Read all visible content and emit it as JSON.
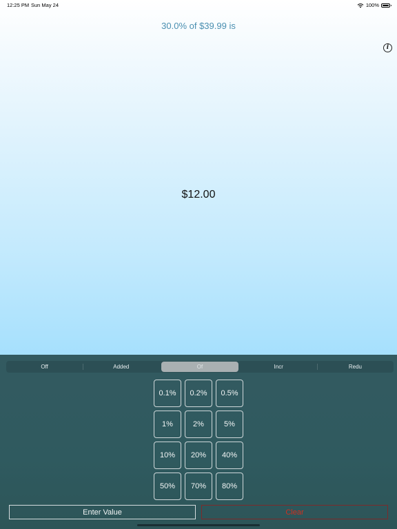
{
  "status_bar": {
    "time": "12:25 PM",
    "date": "Sun May 24",
    "battery": "100%",
    "icons": [
      "wifi-icon",
      "battery-icon"
    ]
  },
  "headline": "30.0% of $39.99 is",
  "info_icon": "info-icon",
  "result": "$12.00",
  "modes": {
    "items": [
      "Off",
      "Added",
      "Of",
      "Incr",
      "Redu"
    ],
    "selected": "Of"
  },
  "keys": [
    "0.1%",
    "0.2%",
    "0.5%",
    "1%",
    "2%",
    "5%",
    "10%",
    "20%",
    "40%",
    "50%",
    "70%",
    "80%"
  ],
  "actions": {
    "enter_value": "Enter Value",
    "clear": "Clear"
  },
  "colors": {
    "headline": "#4a8fb0",
    "panel": "#2f5a5f",
    "clear": "#d03020"
  }
}
